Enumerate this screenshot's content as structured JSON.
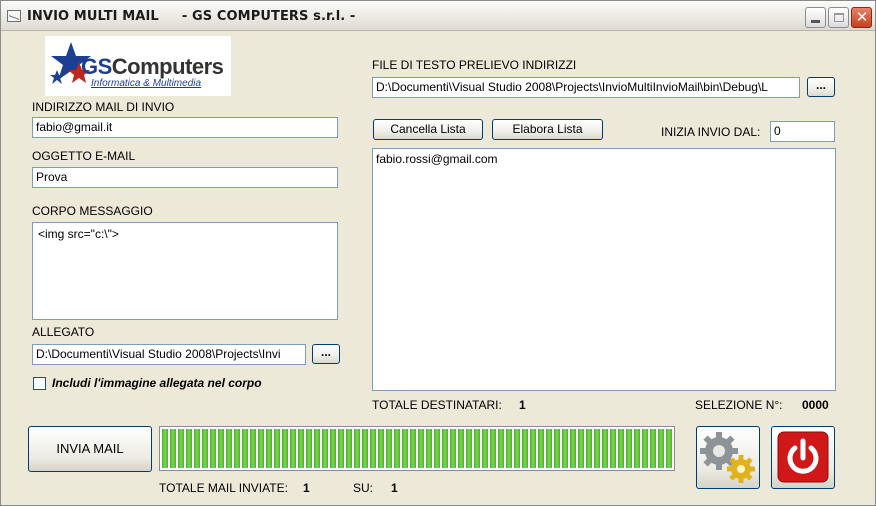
{
  "window": {
    "title": "INVIO MULTI MAIL     - GS COMPUTERS s.r.l. -",
    "close_glyph": "✕"
  },
  "logo": {
    "brand_prefix": "GS",
    "brand_suffix": "Computers",
    "tagline": "Informatica & Multimedia"
  },
  "sender": {
    "label": "INDIRIZZO MAIL DI INVIO",
    "value": "fabio@gmail.it"
  },
  "subject": {
    "label": "OGGETTO E-MAIL",
    "value": "Prova"
  },
  "body": {
    "label": "CORPO MESSAGGIO",
    "value": "<img src=\"c:\\\">"
  },
  "attachment": {
    "label": "ALLEGATO",
    "value": "D:\\Documenti\\Visual Studio 2008\\Projects\\Invi",
    "browse_label": "..."
  },
  "include_image": {
    "label": "Includi l'immagine allegata nel corpo",
    "checked": false
  },
  "address_file": {
    "label": "FILE DI TESTO PRELIEVO INDIRIZZI",
    "value": "D:\\Documenti\\Visual Studio 2008\\Projects\\InvioMultiInvioMail\\bin\\Debug\\L",
    "browse_label": "..."
  },
  "list_actions": {
    "clear_label": "Cancella Lista",
    "process_label": "Elabora Lista"
  },
  "start_from": {
    "label": "INIZIA INVIO DAL:",
    "value": "0"
  },
  "recipients": {
    "items": [
      "fabio.rossi@gmail.com"
    ]
  },
  "totals": {
    "recipients_label": "TOTALE DESTINATARI:",
    "recipients_value": "1",
    "selection_label": "SELEZIONE N°:",
    "selection_value": "0000"
  },
  "send": {
    "button_label": "INVIA MAIL",
    "progress": 1.0,
    "sent_label": "TOTALE MAIL INVIATE:",
    "sent_value": "1",
    "of_label": "SU:",
    "of_value": "1"
  },
  "icons": {
    "settings": "gears-icon",
    "exit": "power-icon"
  },
  "colors": {
    "progress_green": "#44b81e",
    "exit_red": "#d01818"
  }
}
